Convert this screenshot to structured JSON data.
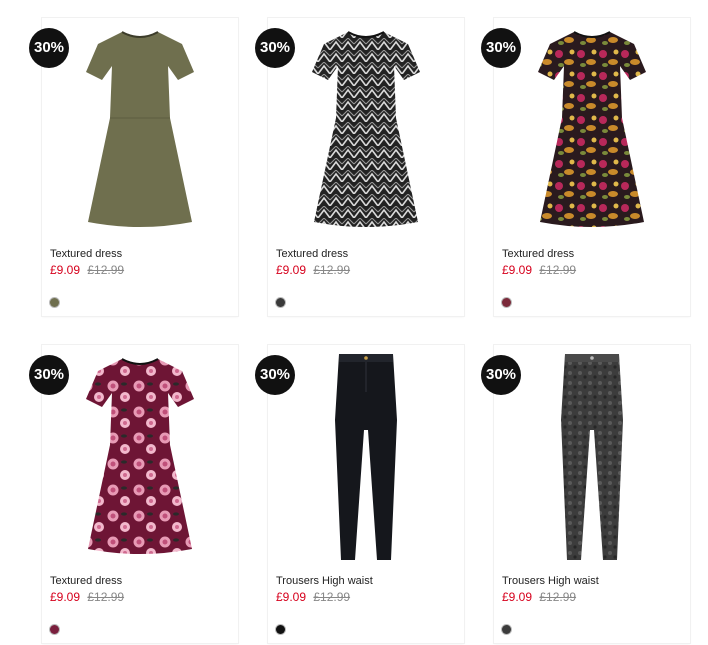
{
  "products": [
    {
      "badge": "30%",
      "name": "Textured dress",
      "price_now": "£9.09",
      "price_was": "£12.99",
      "image": "khaki-textured-dress",
      "swatch_color": "#6f6f4e",
      "garment_color": "#6f6f4e",
      "pattern_color": "#6f6f4e"
    },
    {
      "badge": "30%",
      "name": "Textured dress",
      "price_now": "£9.09",
      "price_was": "£12.99",
      "image": "black-white-patterned-dress",
      "swatch_color": "#3a3a3a",
      "garment_color": "#222222",
      "pattern_color": "#d9d9d9"
    },
    {
      "badge": "30%",
      "name": "Textured dress",
      "price_now": "£9.09",
      "price_was": "£12.99",
      "image": "floral-dress-black",
      "swatch_color": "#7b2a3a",
      "garment_color": "#2a1a1e",
      "pattern_color": "#c98a2a"
    },
    {
      "badge": "30%",
      "name": "Textured dress",
      "price_now": "£9.09",
      "price_was": "£12.99",
      "image": "rose-print-dress-burgundy",
      "swatch_color": "#7a1f3d",
      "garment_color": "#6e1535",
      "pattern_color": "#e79ab5"
    },
    {
      "badge": "30%",
      "name": "Trousers High waist",
      "price_now": "£9.09",
      "price_was": "£12.99",
      "image": "black-trousers",
      "swatch_color": "#111111",
      "garment_color": "#15171c",
      "pattern_color": "#15171c"
    },
    {
      "badge": "30%",
      "name": "Trousers High waist",
      "price_now": "£9.09",
      "price_was": "£12.99",
      "image": "acid-wash-trousers",
      "swatch_color": "#3b3b3b",
      "garment_color": "#3c3c3c",
      "pattern_color": "#5a5a5a"
    }
  ]
}
